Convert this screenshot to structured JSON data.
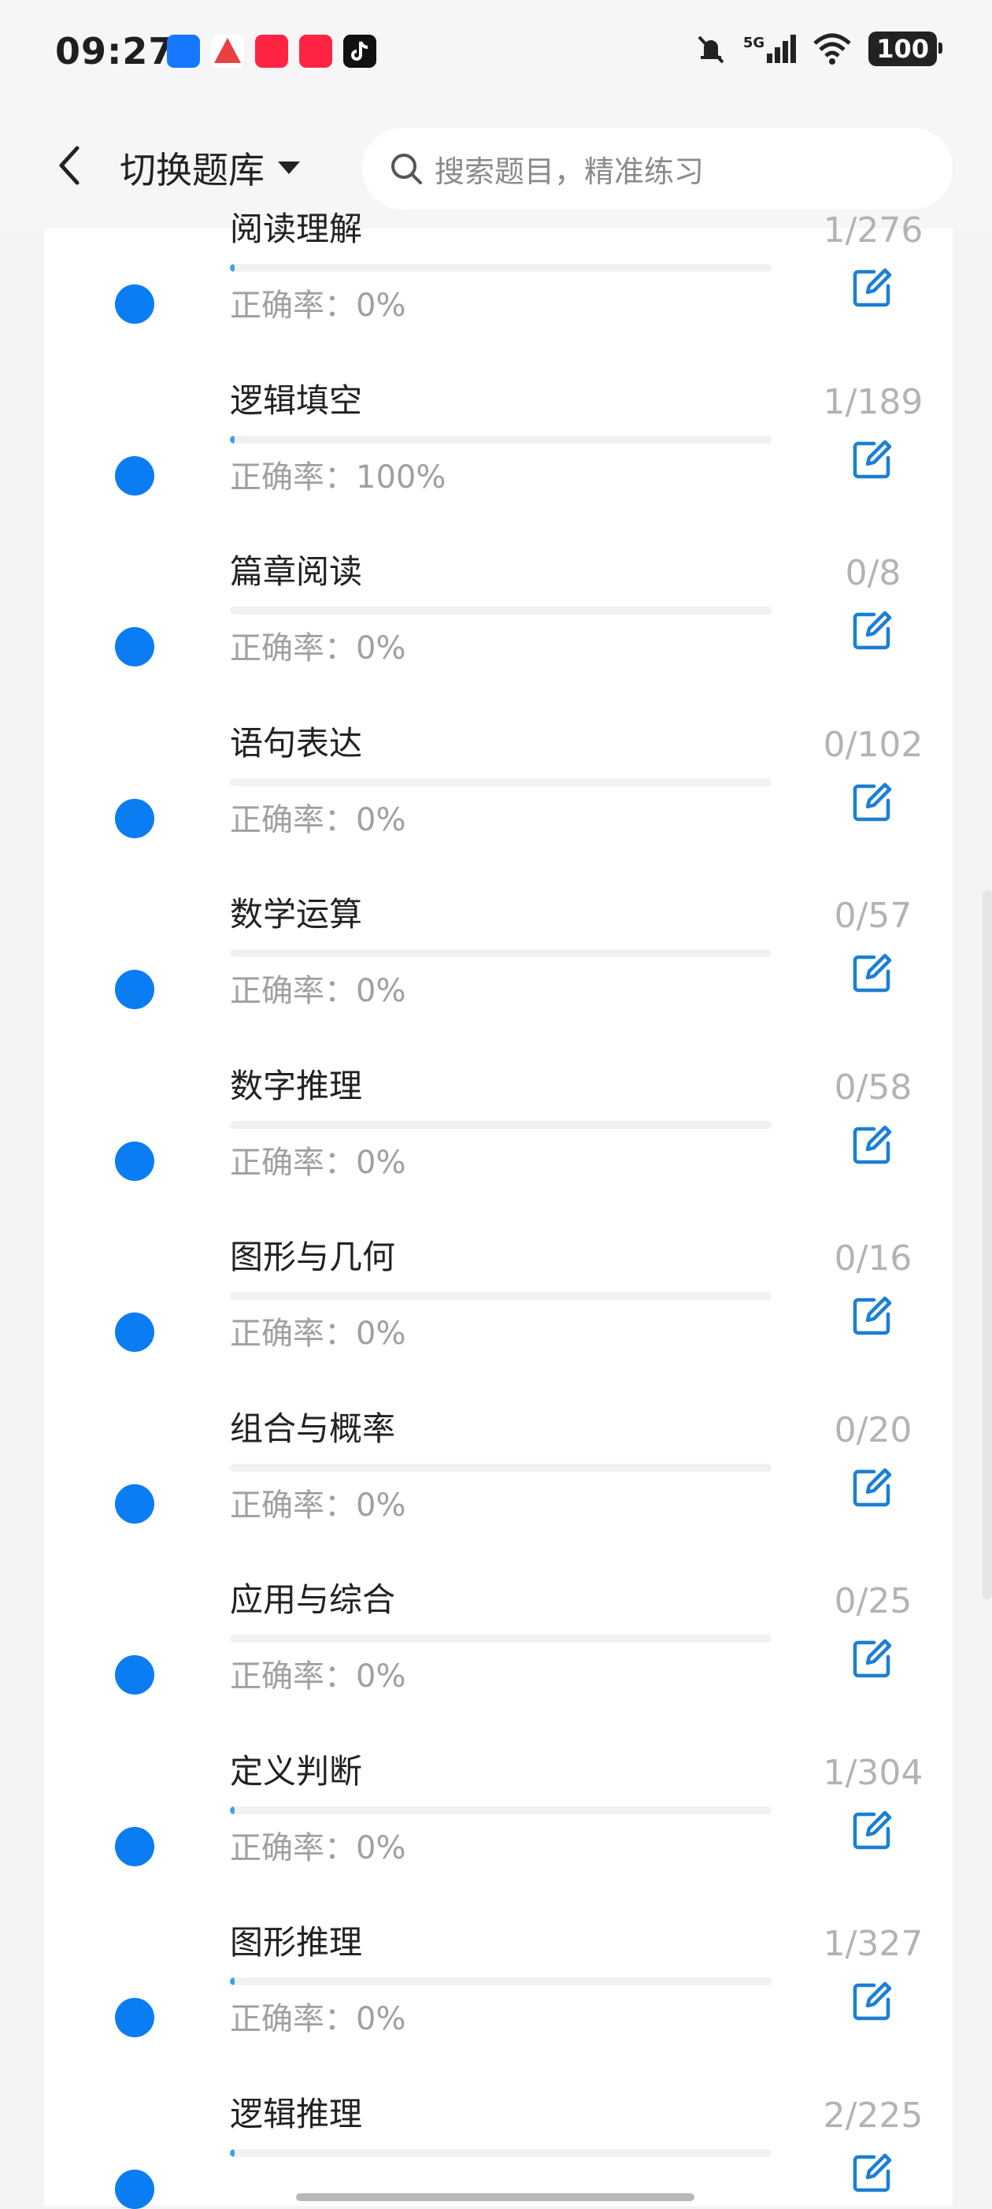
{
  "status": {
    "time": "09:27",
    "network": "5G",
    "battery": "100"
  },
  "notifications": [
    {
      "icon": "alipay-app-icon",
      "color": "#1677ff"
    },
    {
      "icon": "pinduoduo-app-icon",
      "color": "#e8413f"
    },
    {
      "icon": "xiaohongshu-app-icon",
      "color": "#ff2442"
    },
    {
      "icon": "xiaohongshu-app-icon",
      "color": "#ff2442"
    },
    {
      "icon": "tiktok-app-icon",
      "color": "#111111"
    }
  ],
  "header": {
    "switch_label": "切换题库",
    "search_placeholder": "搜索题目，精准练习"
  },
  "accent": "#0a7df2",
  "rows": [
    {
      "title": "阅读理解",
      "count": "1/276",
      "accuracy": "正确率：0%",
      "progress": 0.004
    },
    {
      "title": "逻辑填空",
      "count": "1/189",
      "accuracy": "正确率：100%",
      "progress": 0.005
    },
    {
      "title": "篇章阅读",
      "count": "0/8",
      "accuracy": "正确率：0%",
      "progress": 0
    },
    {
      "title": "语句表达",
      "count": "0/102",
      "accuracy": "正确率：0%",
      "progress": 0
    },
    {
      "title": "数学运算",
      "count": "0/57",
      "accuracy": "正确率：0%",
      "progress": 0
    },
    {
      "title": "数字推理",
      "count": "0/58",
      "accuracy": "正确率：0%",
      "progress": 0
    },
    {
      "title": "图形与几何",
      "count": "0/16",
      "accuracy": "正确率：0%",
      "progress": 0
    },
    {
      "title": "组合与概率",
      "count": "0/20",
      "accuracy": "正确率：0%",
      "progress": 0
    },
    {
      "title": "应用与综合",
      "count": "0/25",
      "accuracy": "正确率：0%",
      "progress": 0
    },
    {
      "title": "定义判断",
      "count": "1/304",
      "accuracy": "正确率：0%",
      "progress": 0.003
    },
    {
      "title": "图形推理",
      "count": "1/327",
      "accuracy": "正确率：0%",
      "progress": 0.003
    },
    {
      "title": "逻辑推理",
      "count": "2/225",
      "accuracy": "",
      "progress": 0.009
    }
  ]
}
